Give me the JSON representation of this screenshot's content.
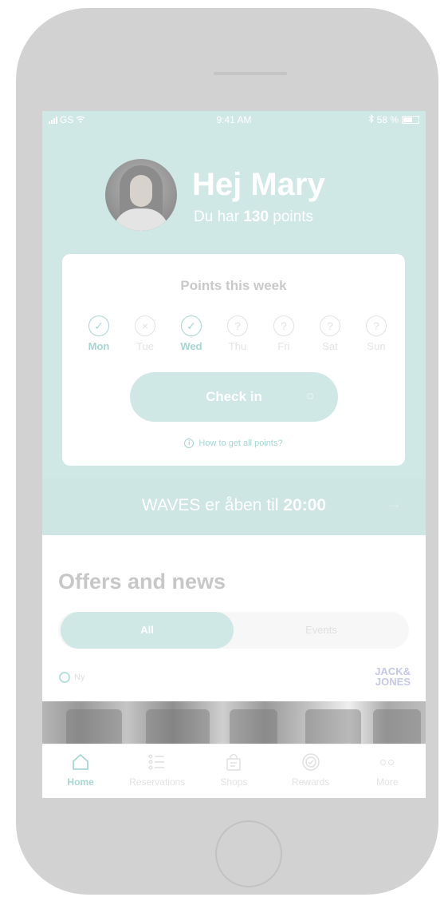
{
  "status_bar": {
    "carrier": "GS",
    "time": "9:41 AM",
    "battery": "58 %",
    "bluetooth_icon": "bluetooth-icon",
    "wifi_icon": "wifi-icon"
  },
  "header": {
    "greeting": "Hej Mary",
    "points_prefix": "Du har",
    "points_value": "130",
    "points_suffix": "points"
  },
  "weekly_card": {
    "title": "Points this week",
    "days": [
      {
        "label": "Mon",
        "status": "done"
      },
      {
        "label": "Tue",
        "status": "missed"
      },
      {
        "label": "Wed",
        "status": "done"
      },
      {
        "label": "Thu",
        "status": "unknown"
      },
      {
        "label": "Fri",
        "status": "unknown"
      },
      {
        "label": "Sat",
        "status": "unknown"
      },
      {
        "label": "Sun",
        "status": "unknown"
      }
    ],
    "checkin_label": "Check in",
    "howto_label": "How to get all points?"
  },
  "store_banner": {
    "text_prefix": "WAVES er åben til",
    "close_time": "20:00",
    "arrow_icon": "arrow-right-icon"
  },
  "offers": {
    "title": "Offers and news",
    "tabs": [
      "All",
      "Events"
    ],
    "active_tab": "All",
    "badge": "Ny",
    "brand_line1": "JACK&",
    "brand_line2": "JONES"
  },
  "tab_bar": {
    "items": [
      {
        "label": "Home",
        "icon": "home-icon",
        "active": true
      },
      {
        "label": "Reservations",
        "icon": "list-icon",
        "active": false
      },
      {
        "label": "Shops",
        "icon": "shopping-bag-icon",
        "active": false
      },
      {
        "label": "Rewards",
        "icon": "rewards-icon",
        "active": false
      },
      {
        "label": "More",
        "icon": "more-icon",
        "active": false
      }
    ]
  },
  "colors": {
    "accent": "#cfe7e5",
    "accent_text": "#a7d6d3",
    "device": "#d2d2d2"
  }
}
